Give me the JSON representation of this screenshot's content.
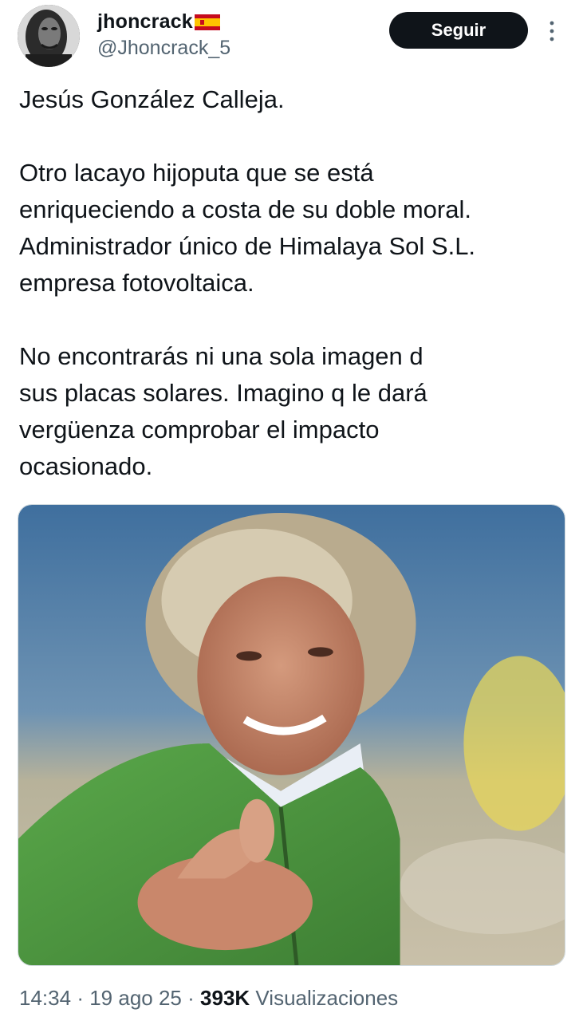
{
  "author": {
    "display_name": "jhoncrack",
    "flag": "spain-flag-icon",
    "handle": "@Jhoncrack_5",
    "follow_label": "Seguir"
  },
  "tweet": {
    "paragraphs": [
      [
        "Jesús González Calleja."
      ],
      [
        "Otro lacayo hijoputa que se está",
        "enriqueciendo a costa de su doble moral.",
        "Administrador único de Himalaya Sol S.L.",
        "empresa fotovoltaica."
      ],
      [
        "No encontrarás ni una sola imagen d",
        "sus placas solares. Imagino q le dará",
        "vergüenza comprobar el impacto",
        "ocasionado."
      ]
    ]
  },
  "meta": {
    "time": "14:34",
    "separator": "·",
    "date": "19 ago 25",
    "views_count": "393K",
    "views_label": "Visualizaciones"
  },
  "colors": {
    "text": "#0f1419",
    "secondary": "#536471",
    "follow_bg": "#0f1419",
    "jacket": "#4f9a3f"
  }
}
